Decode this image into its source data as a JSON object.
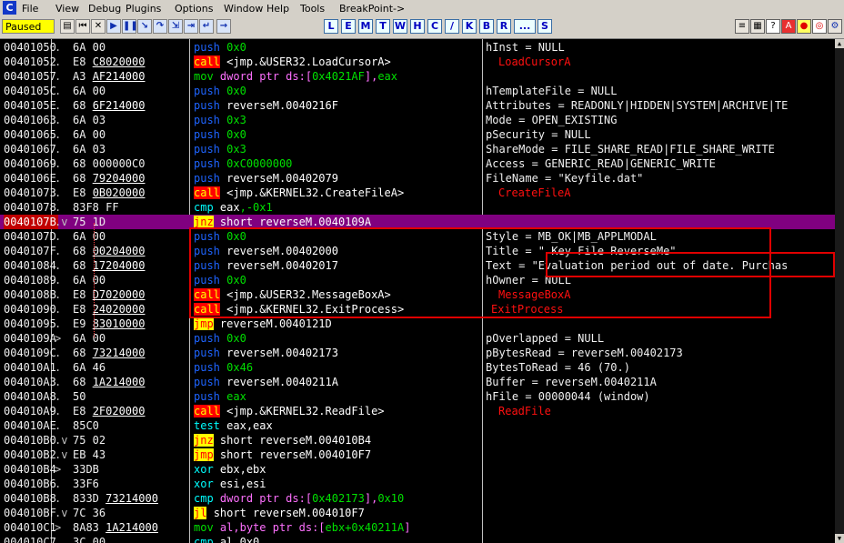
{
  "menu": {
    "app_icon": "C",
    "items": [
      "File",
      "View",
      "Debug",
      "Plugins",
      "Options",
      "Window",
      "Help",
      "Tools",
      "BreakPoint->"
    ]
  },
  "toolbar": {
    "status": "Paused",
    "buttons": [
      "open-icon",
      "restart-icon",
      "close-icon",
      "run-icon",
      "pause-icon",
      "step-into-icon",
      "step-over-icon",
      "trace-into-icon",
      "trace-over-icon",
      "execute-till-return-icon",
      "goto-icon"
    ],
    "letters": [
      "L",
      "E",
      "M",
      "T",
      "W",
      "H",
      "C",
      "/",
      "K",
      "B",
      "R",
      "...",
      "S"
    ],
    "right_icons": [
      "list-icon",
      "grid-icon",
      "help-icon",
      "a-icon",
      "record-icon",
      "target-icon",
      "gear-icon"
    ]
  },
  "rows": [
    {
      "addr": "00401050",
      "mark": ".",
      "hex": "6A 00",
      "mn": "push",
      "cls": "push",
      "ops": [
        [
          "0x0",
          "num"
        ]
      ],
      "comment": "hInst = NULL"
    },
    {
      "addr": "00401052",
      "mark": ".",
      "hex": "E8 ",
      "hexu": "C8020000",
      "mn": "call",
      "cls": "call",
      "ops": [
        [
          "<jmp.&USER32.LoadCursorA>",
          "w"
        ]
      ],
      "comment": "LoadCursorA",
      "ctype": "api"
    },
    {
      "addr": "00401057",
      "mark": ".",
      "hex": "A3 ",
      "hexu": "AF214000",
      "mn": "mov",
      "cls": "mov",
      "ops": [
        [
          "dword ptr ds:[",
          "ptr"
        ],
        [
          "0x4021AF",
          "ptrn"
        ],
        [
          "],",
          "ptr"
        ],
        [
          "eax",
          "num"
        ]
      ],
      "comment": ""
    },
    {
      "addr": "0040105C",
      "mark": ".",
      "hex": "6A 00",
      "mn": "push",
      "cls": "push",
      "ops": [
        [
          "0x0",
          "num"
        ]
      ],
      "comment": "hTemplateFile = NULL"
    },
    {
      "addr": "0040105E",
      "mark": ".",
      "hex": "68 ",
      "hexu": "6F214000",
      "mn": "push",
      "cls": "push",
      "ops": [
        [
          "reverseM.0040216F",
          "w"
        ]
      ],
      "comment": "Attributes = READONLY|HIDDEN|SYSTEM|ARCHIVE|TE"
    },
    {
      "addr": "00401063",
      "mark": ".",
      "hex": "6A 03",
      "mn": "push",
      "cls": "push",
      "ops": [
        [
          "0x3",
          "num"
        ]
      ],
      "comment": "Mode = OPEN_EXISTING"
    },
    {
      "addr": "00401065",
      "mark": ".",
      "hex": "6A 00",
      "mn": "push",
      "cls": "push",
      "ops": [
        [
          "0x0",
          "num"
        ]
      ],
      "comment": "pSecurity = NULL"
    },
    {
      "addr": "00401067",
      "mark": ".",
      "hex": "6A 03",
      "mn": "push",
      "cls": "push",
      "ops": [
        [
          "0x3",
          "num"
        ]
      ],
      "comment": "ShareMode = FILE_SHARE_READ|FILE_SHARE_WRITE"
    },
    {
      "addr": "00401069",
      "mark": ".",
      "hex": "68 000000C0",
      "mn": "push",
      "cls": "push",
      "ops": [
        [
          "0xC0000000",
          "num"
        ]
      ],
      "comment": "Access = GENERIC_READ|GENERIC_WRITE"
    },
    {
      "addr": "0040106E",
      "mark": ".",
      "hex": "68 ",
      "hexu": "79204000",
      "mn": "push",
      "cls": "push",
      "ops": [
        [
          "reverseM.00402079",
          "w"
        ]
      ],
      "comment": "FileName = \"Keyfile.dat\""
    },
    {
      "addr": "00401073",
      "mark": ".",
      "hex": "E8 ",
      "hexu": "0B020000",
      "mn": "call",
      "cls": "call",
      "ops": [
        [
          "<jmp.&KERNEL32.CreateFileA>",
          "w"
        ]
      ],
      "comment": "CreateFileA",
      "ctype": "api"
    },
    {
      "addr": "00401078",
      "mark": ".",
      "hex": "83F8 FF",
      "mn": "cmp",
      "cls": "gen",
      "ops": [
        [
          "eax",
          "w"
        ],
        [
          ",-0x1",
          "num"
        ]
      ],
      "comment": ""
    },
    {
      "addr": "0040107B",
      "mark": ".v",
      "hex": "75 1D",
      "mn": "jnz",
      "cls": "jcc",
      "ops": [
        [
          "short reverseM.0040109A",
          "w"
        ]
      ],
      "comment": "",
      "sel": true
    },
    {
      "addr": "0040107D",
      "mark": ".",
      "hex": "6A 00",
      "mn": "push",
      "cls": "push",
      "ops": [
        [
          "0x0",
          "num"
        ]
      ],
      "comment": "Style = MB_OK|MB_APPLMODAL"
    },
    {
      "addr": "0040107F",
      "mark": ".",
      "hex": "68 ",
      "hexu": "00204000",
      "mn": "push",
      "cls": "push",
      "ops": [
        [
          "reverseM.00402000",
          "w"
        ]
      ],
      "comment": "Title = \" Key File ReverseMe\""
    },
    {
      "addr": "00401084",
      "mark": ".",
      "hex": "68 ",
      "hexu": "17204000",
      "mn": "push",
      "cls": "push",
      "ops": [
        [
          "reverseM.00402017",
          "w"
        ]
      ],
      "comment": "Text = \"Evaluation period out of date. Purchas"
    },
    {
      "addr": "00401089",
      "mark": ".",
      "hex": "6A 00",
      "mn": "push",
      "cls": "push",
      "ops": [
        [
          "0x0",
          "num"
        ]
      ],
      "comment": "hOwner = NULL"
    },
    {
      "addr": "0040108B",
      "mark": ".",
      "hex": "E8 ",
      "hexu": "D7020000",
      "mn": "call",
      "cls": "call",
      "ops": [
        [
          "<jmp.&USER32.MessageBoxA>",
          "w"
        ]
      ],
      "comment": "MessageBoxA",
      "ctype": "api"
    },
    {
      "addr": "00401090",
      "mark": ".",
      "hex": "E8 ",
      "hexu": "24020000",
      "mn": "call",
      "cls": "call",
      "ops": [
        [
          "<jmp.&KERNEL32.ExitProcess>",
          "w"
        ]
      ],
      "comment": "ExitProcess",
      "ctype": "api0"
    },
    {
      "addr": "00401095",
      "mark": ".",
      "hex": "E9 ",
      "hexu": "83010000",
      "mn": "jmp",
      "cls": "jmp",
      "ops": [
        [
          "reverseM.0040121D",
          "w"
        ]
      ],
      "comment": ""
    },
    {
      "addr": "0040109A",
      "mark": ">",
      "hex": "6A 00",
      "mn": "push",
      "cls": "push",
      "ops": [
        [
          "0x0",
          "num"
        ]
      ],
      "comment": "pOverlapped = NULL"
    },
    {
      "addr": "0040109C",
      "mark": ".",
      "hex": "68 ",
      "hexu": "73214000",
      "mn": "push",
      "cls": "push",
      "ops": [
        [
          "reverseM.00402173",
          "w"
        ]
      ],
      "comment": "pBytesRead = reverseM.00402173"
    },
    {
      "addr": "004010A1",
      "mark": ".",
      "hex": "6A 46",
      "mn": "push",
      "cls": "push",
      "ops": [
        [
          "0x46",
          "num"
        ]
      ],
      "comment": "BytesToRead = 46 (70.)"
    },
    {
      "addr": "004010A3",
      "mark": ".",
      "hex": "68 ",
      "hexu": "1A214000",
      "mn": "push",
      "cls": "push",
      "ops": [
        [
          "reverseM.0040211A",
          "w"
        ]
      ],
      "comment": "Buffer = reverseM.0040211A"
    },
    {
      "addr": "004010A8",
      "mark": ".",
      "hex": "50",
      "mn": "push",
      "cls": "push",
      "ops": [
        [
          "eax",
          "num"
        ]
      ],
      "comment": "hFile = 00000044 (window)"
    },
    {
      "addr": "004010A9",
      "mark": ".",
      "hex": "E8 ",
      "hexu": "2F020000",
      "mn": "call",
      "cls": "call",
      "ops": [
        [
          "<jmp.&KERNEL32.ReadFile>",
          "w"
        ]
      ],
      "comment": "ReadFile",
      "ctype": "api"
    },
    {
      "addr": "004010AE",
      "mark": ".",
      "hex": "85C0",
      "mn": "test",
      "cls": "gen",
      "ops": [
        [
          "eax,eax",
          "w"
        ]
      ],
      "comment": ""
    },
    {
      "addr": "004010B0",
      "mark": ".v",
      "hex": "75 02",
      "mn": "jnz",
      "cls": "jmp",
      "ops": [
        [
          "short reverseM.004010B4",
          "w"
        ]
      ],
      "comment": ""
    },
    {
      "addr": "004010B2",
      "mark": ".v",
      "hex": "EB 43",
      "mn": "jmp",
      "cls": "jmp",
      "ops": [
        [
          "short reverseM.004010F7",
          "w"
        ]
      ],
      "comment": ""
    },
    {
      "addr": "004010B4",
      "mark": ">",
      "hex": "33DB",
      "mn": "xor",
      "cls": "gen",
      "ops": [
        [
          "ebx,ebx",
          "w"
        ]
      ],
      "comment": ""
    },
    {
      "addr": "004010B6",
      "mark": ".",
      "hex": "33F6",
      "mn": "xor",
      "cls": "gen",
      "ops": [
        [
          "esi,esi",
          "w"
        ]
      ],
      "comment": ""
    },
    {
      "addr": "004010B8",
      "mark": ".",
      "hex": "833D ",
      "hexu": "73214000",
      "mn": "cmp",
      "cls": "gen",
      "ops": [
        [
          "dword ptr ds:[",
          "ptr"
        ],
        [
          "0x402173",
          "ptrn"
        ],
        [
          "],",
          "ptr"
        ],
        [
          "0x10",
          "num"
        ]
      ],
      "comment": ""
    },
    {
      "addr": "004010BF",
      "mark": ".v",
      "hex": "7C 36",
      "mn": "jl",
      "cls": "jmp",
      "ops": [
        [
          "short reverseM.004010F7",
          "w"
        ]
      ],
      "comment": ""
    },
    {
      "addr": "004010C1",
      "mark": ">",
      "hex": "8A83 ",
      "hexu": "1A214000",
      "mn": "mov",
      "cls": "mov",
      "ops": [
        [
          "al,byte ptr ds:[",
          "ptr"
        ],
        [
          "ebx+0x40211A",
          "ptrn"
        ],
        [
          "]",
          "ptr"
        ]
      ],
      "comment": ""
    },
    {
      "addr": "004010C7",
      "mark": ".",
      "hex": "3C 00",
      "mn": "cmp",
      "cls": "gen",
      "ops": [
        [
          "al,0x0",
          "w"
        ]
      ],
      "comment": ""
    }
  ]
}
